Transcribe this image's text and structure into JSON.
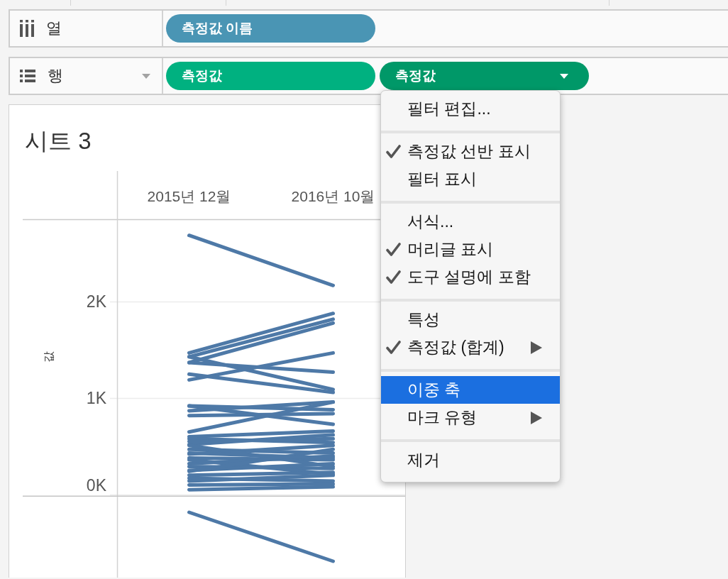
{
  "shelves": [
    {
      "kind": "columns",
      "label": "열",
      "dropdown": false,
      "pills": [
        {
          "label": "측정값 이름",
          "color": "#4a95b4",
          "selected": false
        }
      ]
    },
    {
      "kind": "rows",
      "label": "행",
      "dropdown": true,
      "pills": [
        {
          "label": "측정값",
          "color": "#00b180",
          "selected": false
        },
        {
          "label": "측정값",
          "color": "#009868",
          "selected": true
        }
      ]
    }
  ],
  "sheet": {
    "title": "시트 3",
    "chart_data": {
      "type": "line",
      "ylabel": "값",
      "categories": [
        "2015년 12월",
        "2016년 10월"
      ],
      "ylim": [
        0,
        2850
      ],
      "yticks": [
        {
          "value": 0,
          "label": "0K"
        },
        {
          "value": 1000,
          "label": "1K"
        },
        {
          "value": 2000,
          "label": "2K"
        }
      ],
      "series": [
        {
          "color": "#4e79a7",
          "values": [
            2690,
            2170
          ]
        },
        {
          "color": "#4e79a7",
          "values": [
            1470,
            1880
          ]
        },
        {
          "color": "#4e79a7",
          "values": [
            1430,
            1820
          ]
        },
        {
          "color": "#4e79a7",
          "values": [
            1370,
            1780
          ]
        },
        {
          "color": "#4e79a7",
          "values": [
            1370,
            1270
          ]
        },
        {
          "color": "#4e79a7",
          "values": [
            1190,
            1470
          ]
        },
        {
          "color": "#4e79a7",
          "values": [
            1430,
            1090
          ]
        },
        {
          "color": "#4e79a7",
          "values": [
            1250,
            1060
          ]
        },
        {
          "color": "#4e79a7",
          "values": [
            920,
            730
          ]
        },
        {
          "color": "#4e79a7",
          "values": [
            870,
            960
          ]
        },
        {
          "color": "#4e79a7",
          "values": [
            820,
            840
          ]
        },
        {
          "color": "#4e79a7",
          "values": [
            920,
            880
          ]
        },
        {
          "color": "#4e79a7",
          "values": [
            650,
            960
          ]
        },
        {
          "color": "#4e79a7",
          "values": [
            600,
            660
          ]
        },
        {
          "color": "#4e79a7",
          "values": [
            580,
            540
          ]
        },
        {
          "color": "#4e79a7",
          "values": [
            520,
            620
          ]
        },
        {
          "color": "#4e79a7",
          "values": [
            470,
            430
          ]
        },
        {
          "color": "#4e79a7",
          "values": [
            420,
            510
          ]
        },
        {
          "color": "#4e79a7",
          "values": [
            380,
            360
          ]
        },
        {
          "color": "#4e79a7",
          "values": [
            320,
            400
          ]
        },
        {
          "color": "#4e79a7",
          "values": [
            290,
            270
          ]
        },
        {
          "color": "#4e79a7",
          "values": [
            360,
            210
          ]
        },
        {
          "color": "#4e79a7",
          "values": [
            250,
            320
          ]
        },
        {
          "color": "#4e79a7",
          "values": [
            200,
            230
          ]
        },
        {
          "color": "#4e79a7",
          "values": [
            170,
            140
          ]
        },
        {
          "color": "#4e79a7",
          "values": [
            140,
            200
          ]
        },
        {
          "color": "#4e79a7",
          "values": [
            100,
            110
          ]
        },
        {
          "color": "#4e79a7",
          "values": [
            510,
            290
          ]
        },
        {
          "color": "#4e79a7",
          "values": [
            240,
            470
          ]
        },
        {
          "color": "#4e79a7",
          "values": [
            550,
            580
          ]
        },
        {
          "color": "#4e79a7",
          "values": [
            430,
            380
          ]
        },
        {
          "color": "#4e79a7",
          "values": [
            50,
            80
          ]
        }
      ]
    }
  },
  "context_menu": {
    "sections": [
      {
        "items": [
          {
            "label": "필터 편집...",
            "checked": false,
            "submenu": false,
            "selected": false
          }
        ]
      },
      {
        "items": [
          {
            "label": "측정값 선반 표시",
            "checked": true,
            "submenu": false,
            "selected": false
          },
          {
            "label": "필터 표시",
            "checked": false,
            "submenu": false,
            "selected": false
          }
        ]
      },
      {
        "items": [
          {
            "label": "서식...",
            "checked": false,
            "submenu": false,
            "selected": false
          },
          {
            "label": "머리글 표시",
            "checked": true,
            "submenu": false,
            "selected": false
          },
          {
            "label": "도구 설명에 포함",
            "checked": true,
            "submenu": false,
            "selected": false
          }
        ]
      },
      {
        "items": [
          {
            "label": "특성",
            "checked": false,
            "submenu": false,
            "selected": false
          },
          {
            "label": "측정값 (합계)",
            "checked": true,
            "submenu": true,
            "selected": false
          }
        ]
      },
      {
        "items": [
          {
            "label": "이중 축",
            "checked": false,
            "submenu": false,
            "selected": true
          },
          {
            "label": "마크 유형",
            "checked": false,
            "submenu": true,
            "selected": false
          }
        ]
      },
      {
        "items": [
          {
            "label": "제거",
            "checked": false,
            "submenu": false,
            "selected": false
          }
        ]
      }
    ]
  }
}
